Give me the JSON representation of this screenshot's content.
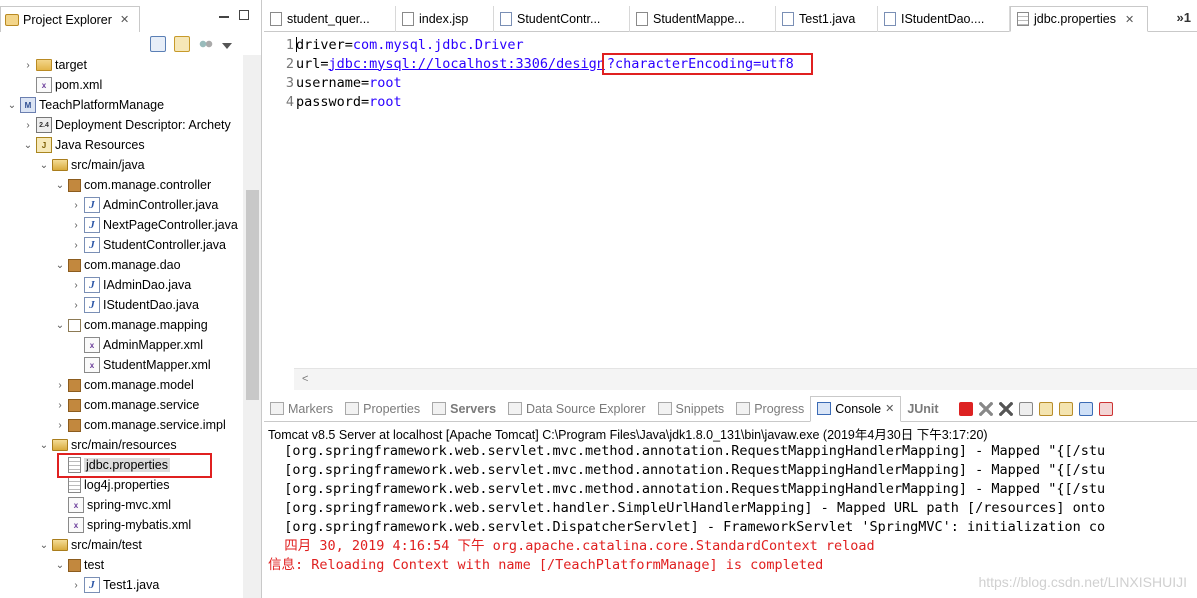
{
  "explorer": {
    "title": "Project Explorer",
    "close": "✕",
    "tree": [
      {
        "label": "target",
        "indent": 1,
        "twisty": "›",
        "icon": "folder"
      },
      {
        "label": "pom.xml",
        "indent": 1,
        "twisty": "",
        "icon": "xml"
      },
      {
        "label": "TeachPlatformManage",
        "indent": 0,
        "twisty": "⌄",
        "icon": "project"
      },
      {
        "label": "Deployment Descriptor: Archety",
        "indent": 1,
        "twisty": "›",
        "icon": "dd"
      },
      {
        "label": "Java Resources",
        "indent": 1,
        "twisty": "⌄",
        "icon": "javares"
      },
      {
        "label": "src/main/java",
        "indent": 2,
        "twisty": "⌄",
        "icon": "srcfolder"
      },
      {
        "label": "com.manage.controller",
        "indent": 3,
        "twisty": "⌄",
        "icon": "pkg"
      },
      {
        "label": "AdminController.java",
        "indent": 4,
        "twisty": "›",
        "icon": "java"
      },
      {
        "label": "NextPageController.java",
        "indent": 4,
        "twisty": "›",
        "icon": "java"
      },
      {
        "label": "StudentController.java",
        "indent": 4,
        "twisty": "›",
        "icon": "java"
      },
      {
        "label": "com.manage.dao",
        "indent": 3,
        "twisty": "⌄",
        "icon": "pkg"
      },
      {
        "label": "IAdminDao.java",
        "indent": 4,
        "twisty": "›",
        "icon": "java"
      },
      {
        "label": "IStudentDao.java",
        "indent": 4,
        "twisty": "›",
        "icon": "java"
      },
      {
        "label": "com.manage.mapping",
        "indent": 3,
        "twisty": "⌄",
        "icon": "pkg-open"
      },
      {
        "label": "AdminMapper.xml",
        "indent": 4,
        "twisty": "",
        "icon": "xml"
      },
      {
        "label": "StudentMapper.xml",
        "indent": 4,
        "twisty": "",
        "icon": "xml"
      },
      {
        "label": "com.manage.model",
        "indent": 3,
        "twisty": "›",
        "icon": "pkg"
      },
      {
        "label": "com.manage.service",
        "indent": 3,
        "twisty": "›",
        "icon": "pkg"
      },
      {
        "label": "com.manage.service.impl",
        "indent": 3,
        "twisty": "›",
        "icon": "pkg"
      },
      {
        "label": "src/main/resources",
        "indent": 2,
        "twisty": "⌄",
        "icon": "srcfolder"
      },
      {
        "label": "jdbc.properties",
        "indent": 3,
        "twisty": "",
        "icon": "props",
        "highlight": true
      },
      {
        "label": "log4j.properties",
        "indent": 3,
        "twisty": "",
        "icon": "props"
      },
      {
        "label": "spring-mvc.xml",
        "indent": 3,
        "twisty": "",
        "icon": "xml"
      },
      {
        "label": "spring-mybatis.xml",
        "indent": 3,
        "twisty": "",
        "icon": "xml"
      },
      {
        "label": "src/main/test",
        "indent": 2,
        "twisty": "⌄",
        "icon": "srcfolder"
      },
      {
        "label": "test",
        "indent": 3,
        "twisty": "⌄",
        "icon": "pkg"
      },
      {
        "label": "Test1.java",
        "indent": 4,
        "twisty": "›",
        "icon": "java"
      }
    ]
  },
  "editor": {
    "tabs": [
      {
        "label": "student_quer...",
        "icon": "file",
        "active": false,
        "width": 132
      },
      {
        "label": "index.jsp",
        "icon": "file",
        "active": false,
        "width": 98
      },
      {
        "label": "StudentContr...",
        "icon": "java",
        "active": false,
        "width": 136
      },
      {
        "label": "StudentMappe...",
        "icon": "file",
        "active": false,
        "width": 146
      },
      {
        "label": "Test1.java",
        "icon": "java",
        "active": false,
        "width": 102
      },
      {
        "label": "IStudentDao....",
        "icon": "java",
        "active": false,
        "width": 132
      },
      {
        "label": "jdbc.properties",
        "icon": "props",
        "active": true,
        "width": 138
      }
    ],
    "tab_close": "✕",
    "overflow": "»1",
    "lines": [
      {
        "n": "1",
        "key": "driver",
        "eq": "=",
        "value": "com.mysql.jdbc.Driver"
      },
      {
        "n": "2",
        "key": "url",
        "eq": "=",
        "value": "jdbc:mysql://localhost:3306/design",
        "value2": "?characterEncoding=utf8"
      },
      {
        "n": "3",
        "key": "username",
        "eq": "=",
        "value": "root"
      },
      {
        "n": "4",
        "key": "password",
        "eq": "=",
        "value": "root"
      }
    ],
    "scroll_arrow": "<"
  },
  "console": {
    "tabs": [
      {
        "label": "Markers",
        "active": false,
        "bold": false
      },
      {
        "label": "Properties",
        "active": false,
        "bold": false
      },
      {
        "label": "Servers",
        "active": false,
        "bold": true
      },
      {
        "label": "Data Source Explorer",
        "active": false,
        "bold": false
      },
      {
        "label": "Snippets",
        "active": false,
        "bold": false
      },
      {
        "label": "Progress",
        "active": false,
        "bold": false
      },
      {
        "label": "Console",
        "active": true,
        "bold": false
      },
      {
        "label": "JUnit",
        "active": false,
        "bold": true
      }
    ],
    "title": "Tomcat v8.5 Server at localhost [Apache Tomcat] C:\\Program Files\\Java\\jdk1.8.0_131\\bin\\javaw.exe (2019年4月30日 下午3:17:20)",
    "lines": [
      {
        "text": "  [org.springframework.web.servlet.mvc.method.annotation.RequestMappingHandlerMapping] - Mapped \"{[/stu",
        "color": "black"
      },
      {
        "text": "  [org.springframework.web.servlet.mvc.method.annotation.RequestMappingHandlerMapping] - Mapped \"{[/stu",
        "color": "black"
      },
      {
        "text": "  [org.springframework.web.servlet.mvc.method.annotation.RequestMappingHandlerMapping] - Mapped \"{[/stu",
        "color": "black"
      },
      {
        "text": "  [org.springframework.web.servlet.handler.SimpleUrlHandlerMapping] - Mapped URL path [/resources] onto",
        "color": "black"
      },
      {
        "text": "  [org.springframework.web.servlet.DispatcherServlet] - FrameworkServlet 'SpringMVC': initialization co",
        "color": "black"
      },
      {
        "text": "  四月 30, 2019 4:16:54 下午 org.apache.catalina.core.StandardContext reload",
        "color": "red"
      },
      {
        "text": "信息: Reloading Context with name [/TeachPlatformManage] is completed",
        "color": "red"
      }
    ],
    "watermark": "https://blog.csdn.net/LINXISHUIJI"
  }
}
